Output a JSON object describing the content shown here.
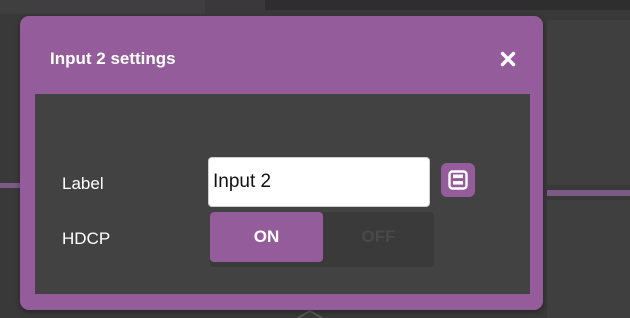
{
  "dialog": {
    "title": "Input 2 settings",
    "close_icon": "close-icon",
    "accent_color": "#945c9a"
  },
  "form": {
    "label_text": "Label",
    "label_value": "Input 2",
    "save_icon": "save-icon",
    "hdcp_text": "HDCP",
    "hdcp_toggle": {
      "on_label": "ON",
      "off_label": "OFF",
      "selected": "ON"
    }
  }
}
